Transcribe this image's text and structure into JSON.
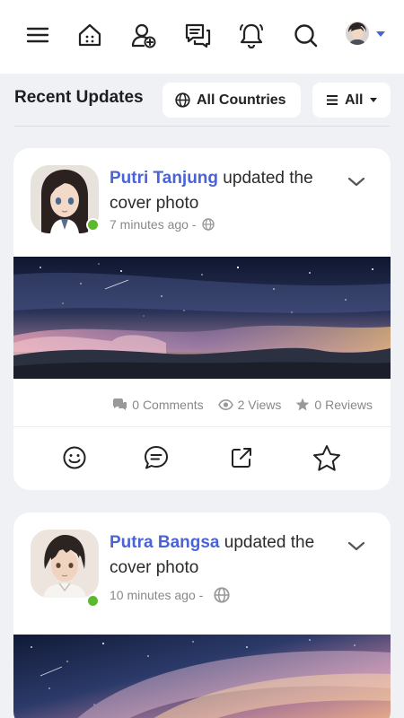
{
  "nav": {
    "icons": [
      "menu-icon",
      "home-icon",
      "add-friend-icon",
      "messages-icon",
      "notifications-icon",
      "search-icon"
    ],
    "accent": "#4a63d6"
  },
  "filters": {
    "title": "Recent Updates",
    "country_label": "All Countries",
    "type_label": "All"
  },
  "posts": [
    {
      "author": "Putri Tanjung",
      "action": " updated the cover photo",
      "time": "7 minutes ago -",
      "comments": "0 Comments",
      "views": "2 Views",
      "reviews": "0 Reviews"
    },
    {
      "author": "Putra Bangsa",
      "action": " updated the cover photo",
      "time": "10 minutes ago -"
    }
  ],
  "colors": {
    "online": "#5cb82e",
    "author": "#4a63d6",
    "background": "#f0f1f5"
  }
}
